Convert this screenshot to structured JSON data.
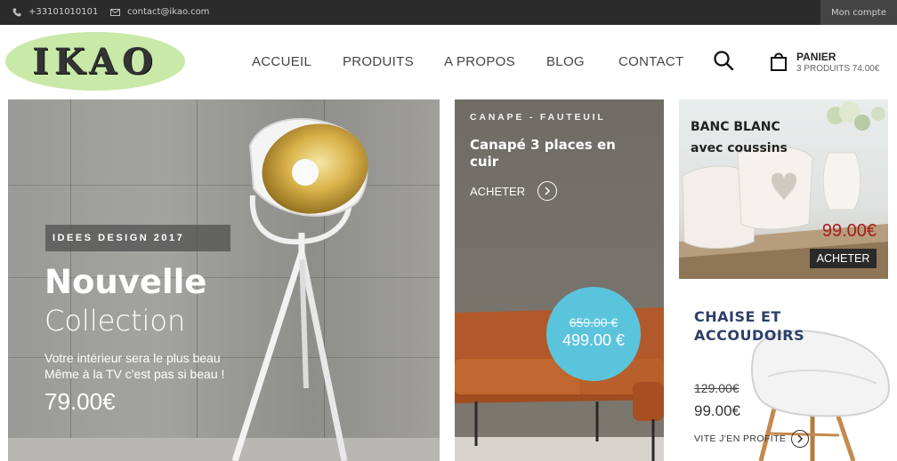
{
  "topbar": {
    "phone": "+33101010101",
    "email": "contact@ikao.com",
    "account": "Mon compte"
  },
  "header": {
    "logo": "IKAO",
    "nav": [
      "ACCUEIL",
      "PRODUITS",
      "A PROPOS",
      "BLOG",
      "CONTACT"
    ],
    "cart_title": "PANIER",
    "cart_summary": "3 PRODUITS 74.00€"
  },
  "hero": {
    "badge": "IDEES DESIGN 2017",
    "title": "Nouvelle",
    "subtitle": "Collection",
    "desc_line1": "Votre intérieur sera le plus beau",
    "desc_line2": "Même à la TV c'est pas si beau !",
    "price": "79.00€"
  },
  "sofa": {
    "category": "CANAPE - FAUTEUIL",
    "title": "Canapé 3 places en cuir",
    "cta": "ACHETER",
    "old_price": "659.00 €",
    "new_price": "499.00 €"
  },
  "bench": {
    "title_line1": "BANC BLANC",
    "title_line2": "avec coussins",
    "price": "99.00€",
    "cta": "ACHETER"
  },
  "chair": {
    "title_line1": "CHAISE ET",
    "title_line2": "ACCOUDOIRS",
    "old_price": "129.00€",
    "new_price": "99.00€",
    "cta": "VITE J'EN PROFITE"
  },
  "colors": {
    "topbar": "#2b2b2b",
    "logo_bg": "#c8e9a8",
    "price_circle": "#5bc4dd",
    "bench_price": "#a81d1d",
    "chair_title": "#2d3f6a"
  },
  "icons": [
    "phone-icon",
    "mail-icon",
    "search-icon",
    "cart-icon",
    "arrow-right-icon"
  ]
}
